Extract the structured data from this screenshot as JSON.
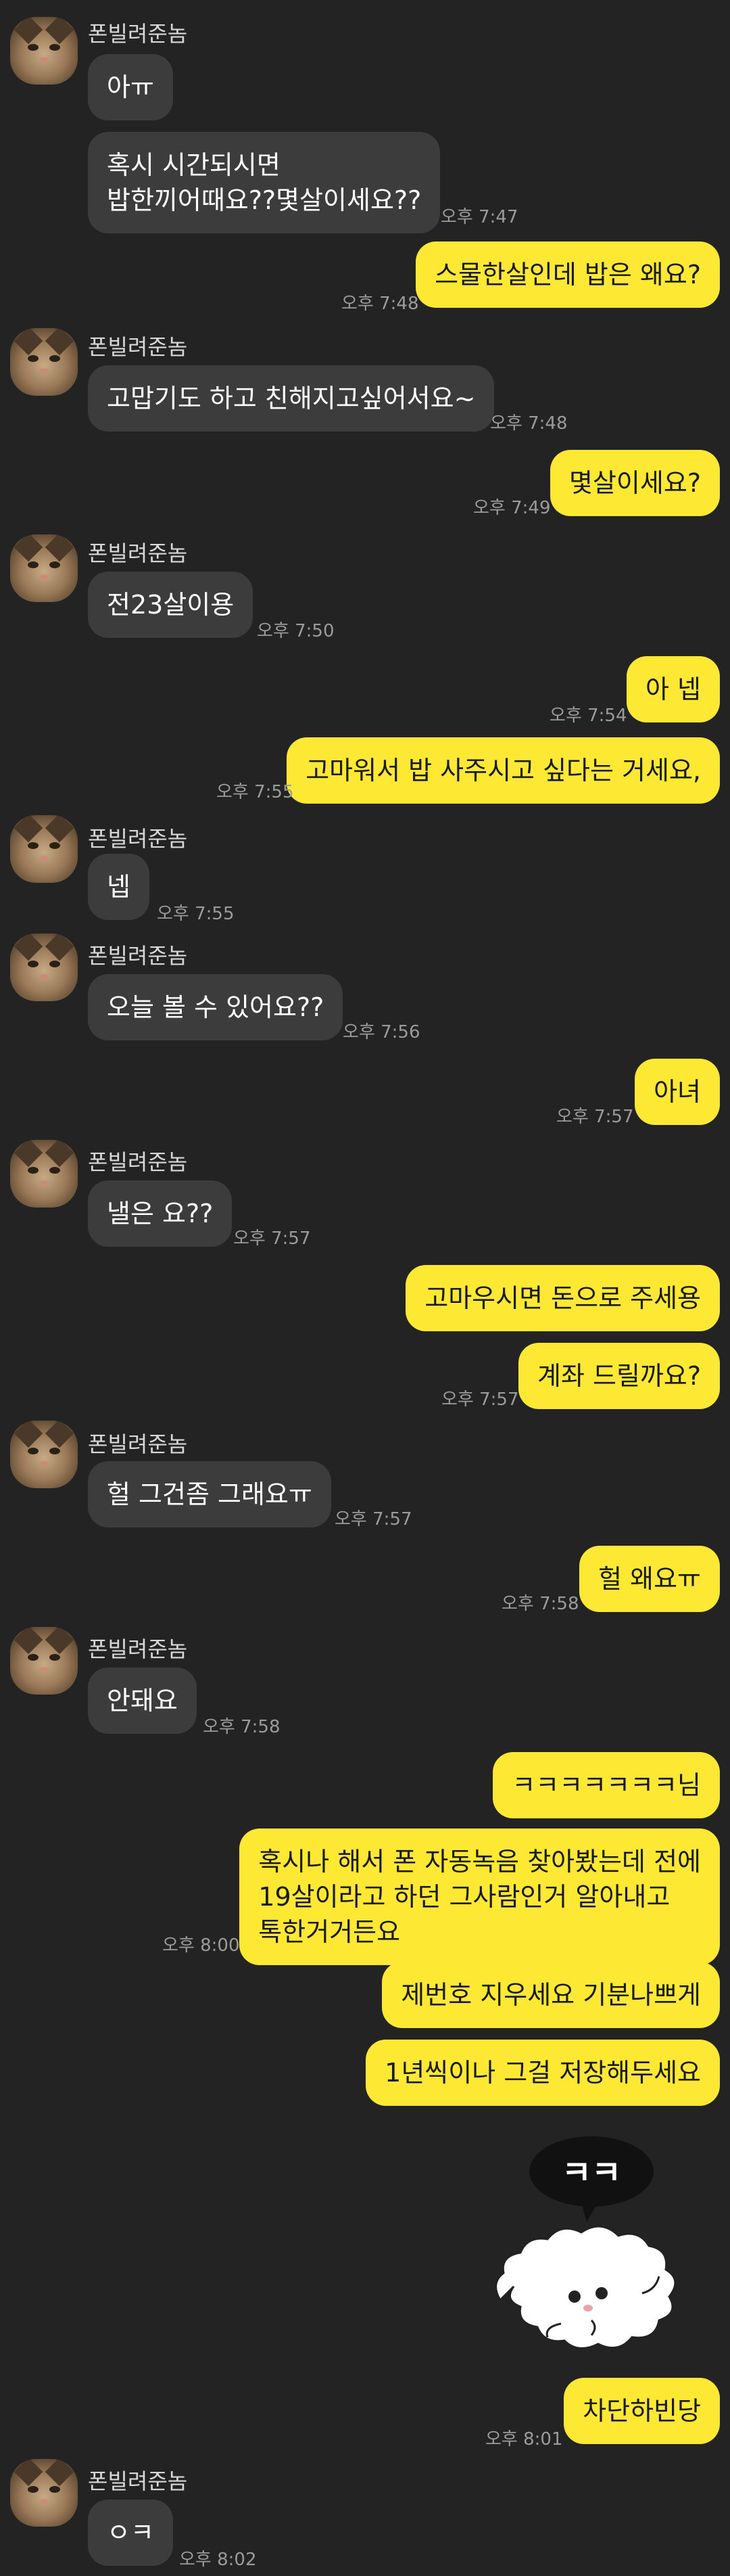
{
  "chat": {
    "contact_name": "폰빌려준놈",
    "messages": [
      {
        "from": "them",
        "text": "아ㅠ"
      },
      {
        "from": "them",
        "lines": [
          "혹시 시간되시면",
          "밥한끼어때요??몇살이세요??"
        ],
        "time": "오후 7:47"
      },
      {
        "from": "me",
        "text": "스물한살인데 밥은 왜요?",
        "time": "오후 7:48"
      },
      {
        "from": "them",
        "text": "고맙기도 하고 친해지고싶어서요~",
        "time": "오후 7:48"
      },
      {
        "from": "me",
        "text": "몇살이세요?",
        "time": "오후 7:49"
      },
      {
        "from": "them",
        "text": "전23살이용",
        "time": "오후 7:50"
      },
      {
        "from": "me",
        "text": "아 넵",
        "time": "오후 7:54"
      },
      {
        "from": "me",
        "text": "고마워서 밥 사주시고 싶다는 거세요,",
        "time": "오후 7:55"
      },
      {
        "from": "them",
        "text": "넵",
        "time": "오후 7:55"
      },
      {
        "from": "them",
        "text": "오늘 볼 수 있어요??",
        "time": "오후 7:56"
      },
      {
        "from": "me",
        "text": "아녀",
        "time": "오후 7:57"
      },
      {
        "from": "them",
        "text": "낼은 요??",
        "time": "오후 7:57"
      },
      {
        "from": "me",
        "text": "고마우시면 돈으로 주세용"
      },
      {
        "from": "me",
        "text": "계좌 드릴까요?",
        "time": "오후 7:57"
      },
      {
        "from": "them",
        "text": "헐 그건좀 그래요ㅠ",
        "time": "오후 7:57"
      },
      {
        "from": "me",
        "text": "헐 왜요ㅠ",
        "time": "오후 7:58"
      },
      {
        "from": "them",
        "text": "안돼요",
        "time": "오후 7:58"
      },
      {
        "from": "me",
        "text": "ㅋㅋㅋㅋㅋㅋㅋ님"
      },
      {
        "from": "me",
        "lines": [
          "혹시나 해서 폰 자동녹음 찾아봤는데 전에",
          "19살이라고 하던 그사람인거 알아내고",
          "톡한거거든요"
        ],
        "time": "오후 8:00"
      },
      {
        "from": "me",
        "text": "제번호 지우세요 기분나쁘게"
      },
      {
        "from": "me",
        "text": "1년씩이나 그걸 저장해두세요"
      },
      {
        "from": "me",
        "sticker": "ㅋㅋ"
      },
      {
        "from": "me",
        "text": "차단하빈당",
        "time": "오후 8:01"
      },
      {
        "from": "them",
        "text": "ㅇㅋ",
        "time": "오후 8:02"
      }
    ]
  },
  "colors": {
    "background": "#232323",
    "incoming_bubble": "#3c3c3c",
    "outgoing_bubble": "#fde833",
    "timestamp": "#9b9b9b"
  },
  "icons": {
    "avatar": "cat-avatar-icon",
    "sticker": "fluffy-sticker-icon"
  }
}
